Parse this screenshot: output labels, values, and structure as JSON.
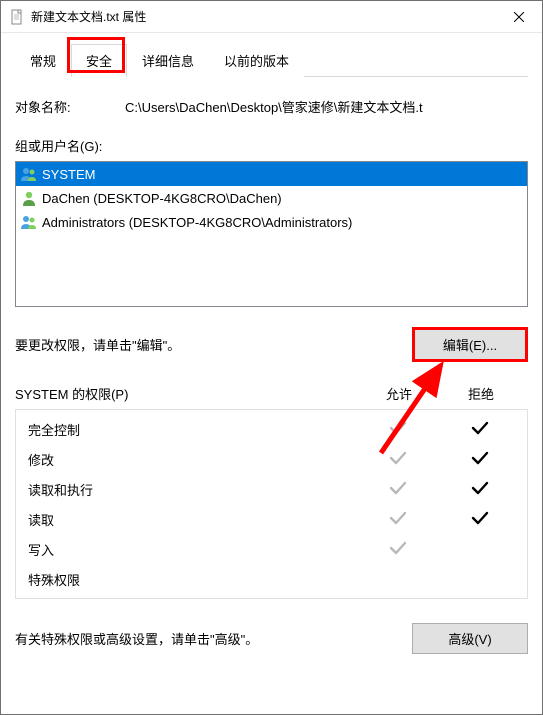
{
  "window": {
    "title": "新建文本文档.txt 属性"
  },
  "tabs": {
    "general": "常规",
    "security": "安全",
    "details": "详细信息",
    "previous": "以前的版本"
  },
  "object": {
    "label": "对象名称:",
    "value": "C:\\Users\\DaChen\\Desktop\\管家速修\\新建文本文档.t"
  },
  "groups": {
    "label": "组或用户名(G):",
    "items": [
      {
        "name": "SYSTEM",
        "type": "group",
        "selected": true
      },
      {
        "name": "DaChen (DESKTOP-4KG8CRO\\DaChen)",
        "type": "user",
        "selected": false
      },
      {
        "name": "Administrators (DESKTOP-4KG8CRO\\Administrators)",
        "type": "group",
        "selected": false
      }
    ]
  },
  "edit": {
    "hint": "要更改权限，请单击\"编辑\"。",
    "button": "编辑(E)..."
  },
  "permissions": {
    "header_label": "SYSTEM 的权限(P)",
    "allow_label": "允许",
    "deny_label": "拒绝",
    "rows": [
      {
        "name": "完全控制",
        "allow": true,
        "deny": true
      },
      {
        "name": "修改",
        "allow": true,
        "deny": true
      },
      {
        "name": "读取和执行",
        "allow": true,
        "deny": true
      },
      {
        "name": "读取",
        "allow": true,
        "deny": true
      },
      {
        "name": "写入",
        "allow": true,
        "deny": false
      },
      {
        "name": "特殊权限",
        "allow": false,
        "deny": false
      }
    ]
  },
  "advanced": {
    "hint": "有关特殊权限或高级设置，请单击\"高级\"。",
    "button": "高级(V)"
  }
}
